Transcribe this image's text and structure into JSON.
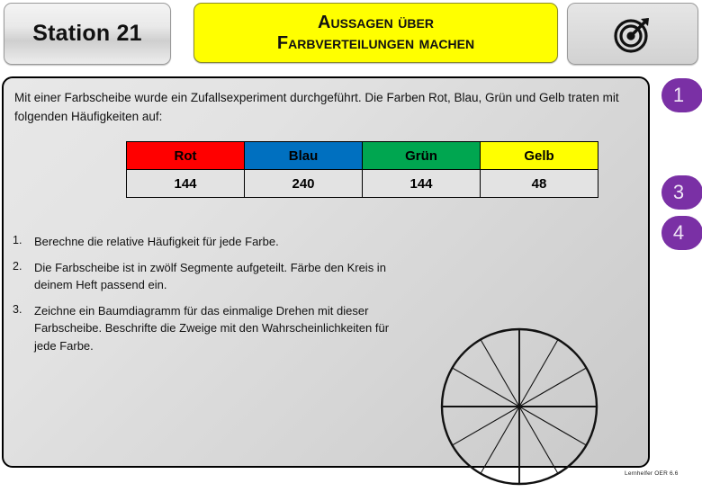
{
  "header": {
    "station_label": "Station 21",
    "title_line1": "Aussagen über",
    "title_line2": "Farbverteilungen machen",
    "icon": "target-icon"
  },
  "main": {
    "intro_text": "Mit einer Farbscheibe wurde ein Zufallsexperiment durchgeführt. Die Farben Rot, Blau, Grün und Gelb traten mit folgenden Häufigkeiten auf:",
    "table": {
      "headers": [
        "Rot",
        "Blau",
        "Grün",
        "Gelb"
      ],
      "header_colors": [
        "#FF0000",
        "#0070C0",
        "#00A650",
        "#FFFF00"
      ],
      "values": [
        "144",
        "240",
        "144",
        "48"
      ]
    },
    "tasks": [
      {
        "number": "1.",
        "text": "Berechne die relative Häufigkeit für jede Farbe."
      },
      {
        "number": "2.",
        "text": "Die Farbscheibe ist in zwölf Segmente aufgeteilt. Färbe den Kreis in deinem Heft passend ein."
      },
      {
        "number": "3.",
        "text": "Zeichne ein Baumdiagramm für das einmalige Drehen mit dieser Farbscheibe. Beschrifte die Zweige mit den Wahrscheinlichkeiten für jede Farbe."
      }
    ],
    "wheel": {
      "segments": 12,
      "label": "farbscheibe-12-segmente"
    }
  },
  "badges": [
    {
      "label": "1"
    },
    {
      "label": "3"
    },
    {
      "label": "4"
    }
  ],
  "footer": {
    "credit": "Lernhelfer OER 6.6"
  },
  "colors": {
    "accent_purple": "#7A30A5",
    "title_yellow": "#FFFF00",
    "panel_gray": "#E2E2E2"
  }
}
